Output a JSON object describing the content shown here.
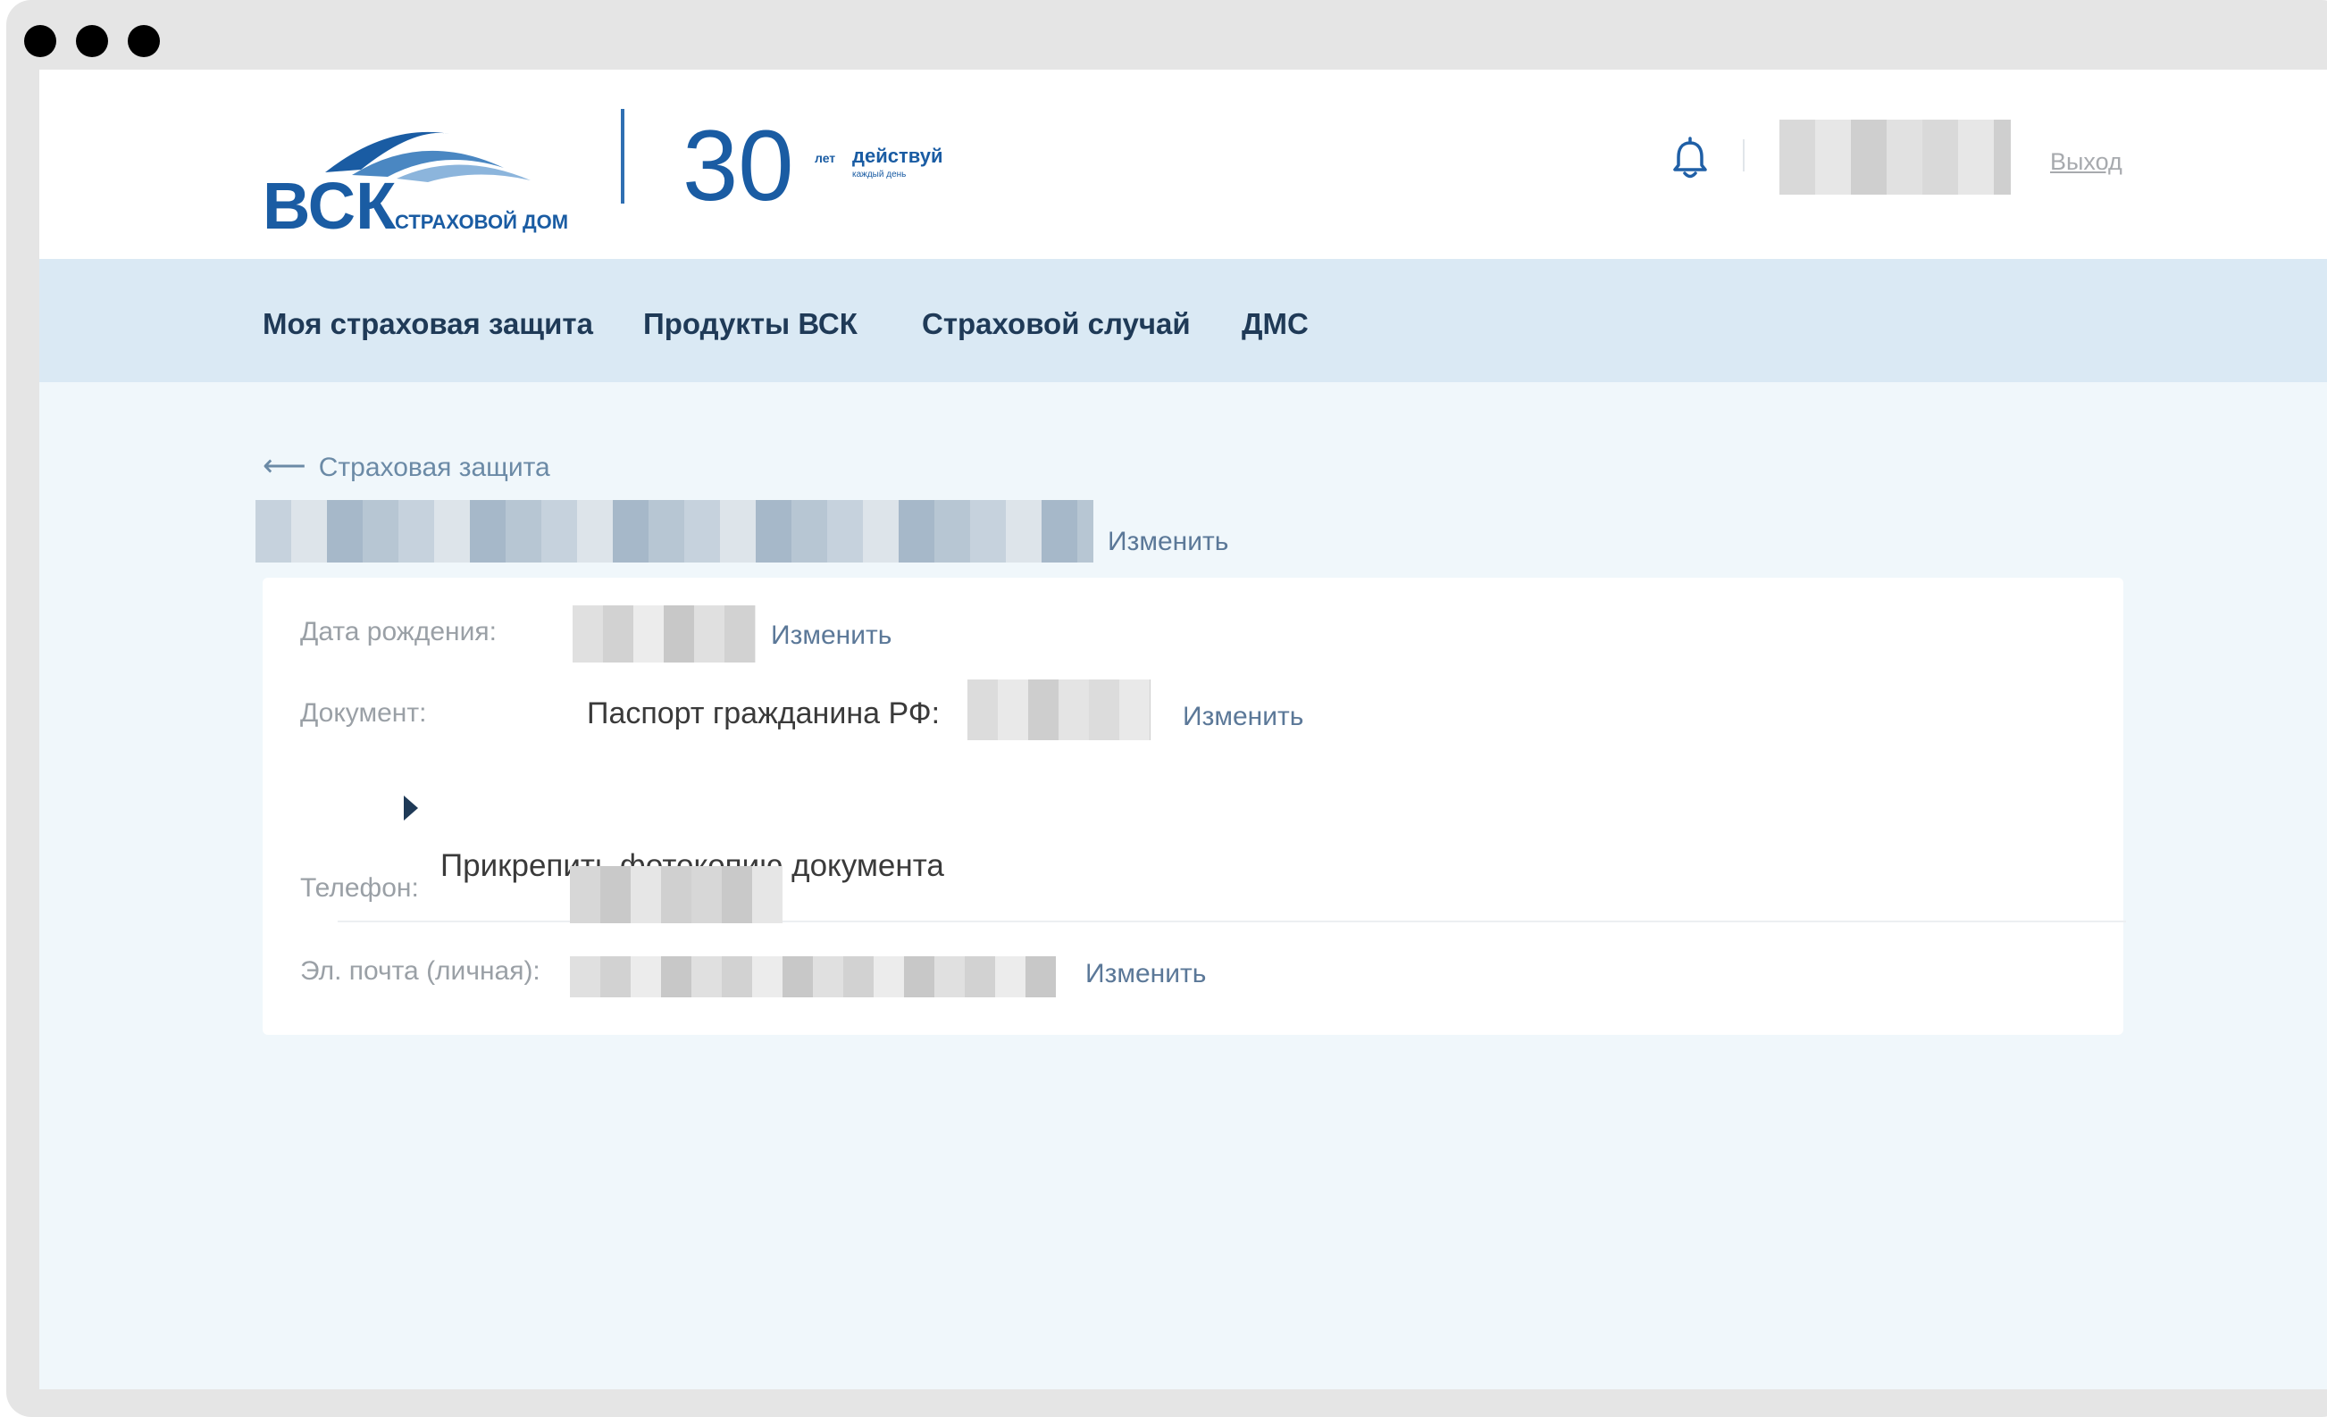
{
  "header": {
    "logo_text": "ВСК",
    "logo_subtitle": "СТРАХОВОЙ ДОМ",
    "anniversary": {
      "number": "30",
      "small": "лет",
      "slogan": "действуй",
      "tagline": "каждый день"
    },
    "logout_label": "Выход"
  },
  "nav": {
    "items": [
      {
        "label": "Моя страховая защита"
      },
      {
        "label": "Продукты ВСК"
      },
      {
        "label": "Страховой случай"
      },
      {
        "label": "ДМС"
      }
    ]
  },
  "breadcrumb": {
    "back_label": "Страховая защита"
  },
  "profile": {
    "name_edit": "Изменить",
    "birth_label": "Дата рождения:",
    "birth_edit": "Изменить",
    "document_label": "Документ:",
    "document_value": "Паспорт гражданина РФ:",
    "document_edit": "Изменить",
    "attach_label": "Прикрепить фотокопию документа",
    "phone_label": "Телефон:",
    "email_label": "Эл. почта (личная):",
    "email_edit": "Изменить"
  },
  "colors": {
    "brand_blue": "#1f5fa6",
    "nav_bg": "#dae9f4",
    "page_bg": "#f0f7fb",
    "link": "#5b7898"
  },
  "icons": {
    "bell": "bell-icon",
    "back": "arrow-left-icon",
    "expand": "caret-right-icon"
  }
}
